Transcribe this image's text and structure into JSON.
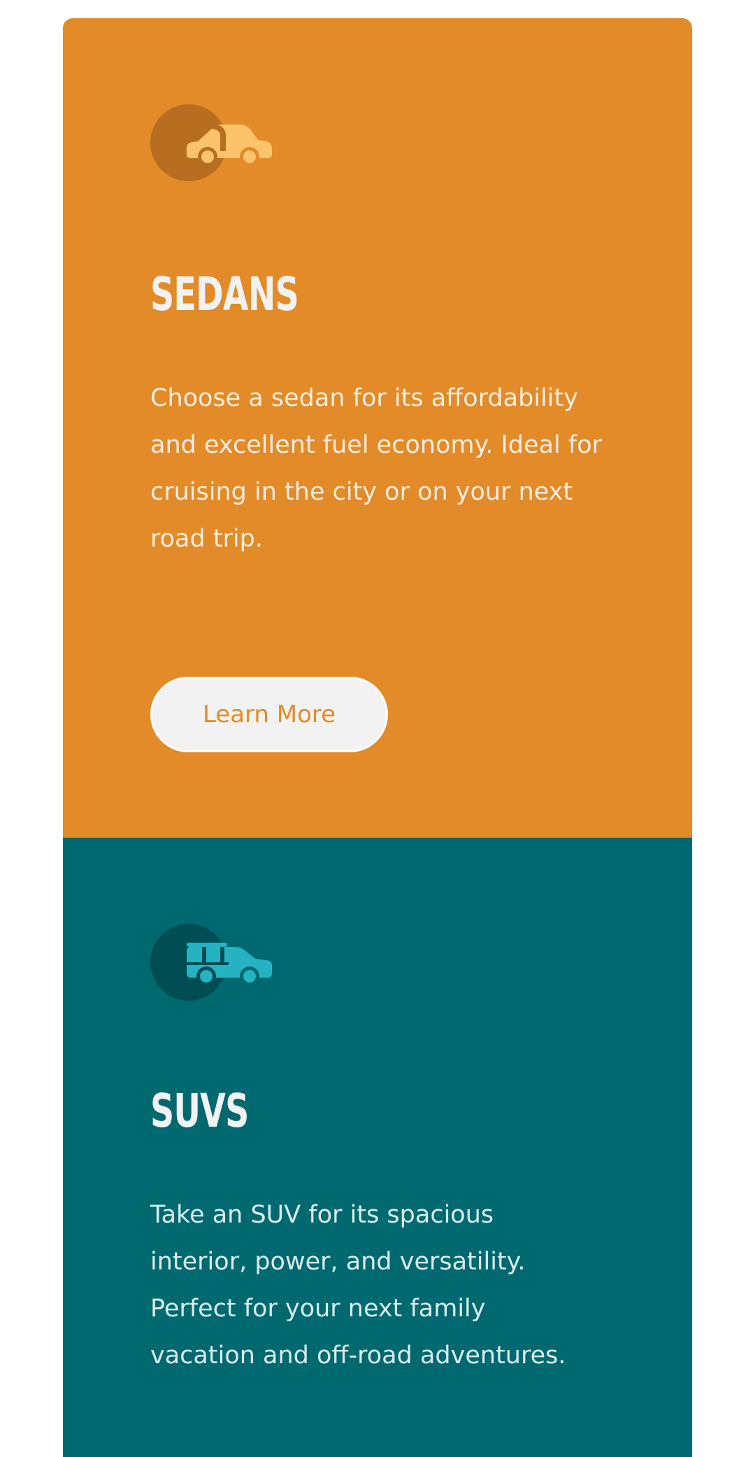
{
  "cards": [
    {
      "icon": "sedan-car-icon",
      "title": "SEDANS",
      "description": "Choose a sedan for its affordability and excellent fuel economy. Ideal for cruising in the city or on your next road trip.",
      "button_label": "Learn More",
      "accent_color": "#e28b28"
    },
    {
      "icon": "suv-car-icon",
      "title": "SUVS",
      "description": "Take an SUV for its spacious interior, power, and versatility. Perfect for your next family vacation and off-road adventures.",
      "accent_color": "#006970"
    }
  ],
  "colors": {
    "sedan_background": "#e28b28",
    "suv_background": "#006970",
    "button_background": "#f2f2f2",
    "heading_text": "#f2f2f2"
  }
}
